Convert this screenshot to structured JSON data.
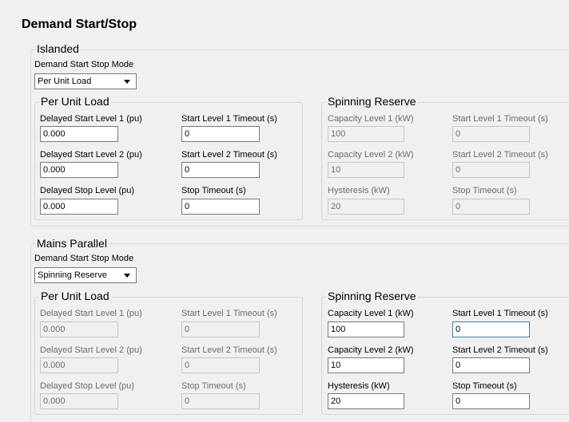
{
  "title": "Demand Start/Stop",
  "islanded": {
    "legend": "Islanded",
    "mode_label": "Demand Start Stop Mode",
    "mode_value": "Per Unit Load",
    "per_unit": {
      "legend": "Per Unit Load",
      "delayed_start_1_label": "Delayed Start Level 1 (pu)",
      "delayed_start_1_value": "0.000",
      "start_timeout_1_label": "Start Level 1 Timeout (s)",
      "start_timeout_1_value": "0",
      "delayed_start_2_label": "Delayed Start Level 2 (pu)",
      "delayed_start_2_value": "0.000",
      "start_timeout_2_label": "Start Level 2 Timeout (s)",
      "start_timeout_2_value": "0",
      "delayed_stop_label": "Delayed Stop Level (pu)",
      "delayed_stop_value": "0.000",
      "stop_timeout_label": "Stop Timeout (s)",
      "stop_timeout_value": "0"
    },
    "spinning": {
      "legend": "Spinning Reserve",
      "capacity_1_label": "Capacity Level 1 (kW)",
      "capacity_1_value": "100",
      "start_timeout_1_label": "Start Level 1 Timeout (s)",
      "start_timeout_1_value": "0",
      "capacity_2_label": "Capacity Level 2 (kW)",
      "capacity_2_value": "10",
      "start_timeout_2_label": "Start Level 2 Timeout (s)",
      "start_timeout_2_value": "0",
      "hysteresis_label": "Hysteresis (kW)",
      "hysteresis_value": "20",
      "stop_timeout_label": "Stop Timeout (s)",
      "stop_timeout_value": "0"
    }
  },
  "mains": {
    "legend": "Mains Parallel",
    "mode_label": "Demand Start Stop Mode",
    "mode_value": "Spinning Reserve",
    "per_unit": {
      "legend": "Per Unit Load",
      "delayed_start_1_label": "Delayed Start Level 1 (pu)",
      "delayed_start_1_value": "0.000",
      "start_timeout_1_label": "Start Level 1 Timeout (s)",
      "start_timeout_1_value": "0",
      "delayed_start_2_label": "Delayed Start Level 2 (pu)",
      "delayed_start_2_value": "0.000",
      "start_timeout_2_label": "Start Level 2 Timeout (s)",
      "start_timeout_2_value": "0",
      "delayed_stop_label": "Delayed Stop Level (pu)",
      "delayed_stop_value": "0.000",
      "stop_timeout_label": "Stop Timeout (s)",
      "stop_timeout_value": "0"
    },
    "spinning": {
      "legend": "Spinning Reserve",
      "capacity_1_label": "Capacity Level 1 (kW)",
      "capacity_1_value": "100",
      "start_timeout_1_label": "Start Level 1 Timeout (s)",
      "start_timeout_1_value": "0",
      "capacity_2_label": "Capacity Level 2 (kW)",
      "capacity_2_value": "10",
      "start_timeout_2_label": "Start Level 2 Timeout (s)",
      "start_timeout_2_value": "0",
      "hysteresis_label": "Hysteresis (kW)",
      "hysteresis_value": "20",
      "stop_timeout_label": "Stop Timeout (s)",
      "stop_timeout_value": "0"
    }
  },
  "icons": {
    "dropdown": "chevron-down-icon"
  }
}
